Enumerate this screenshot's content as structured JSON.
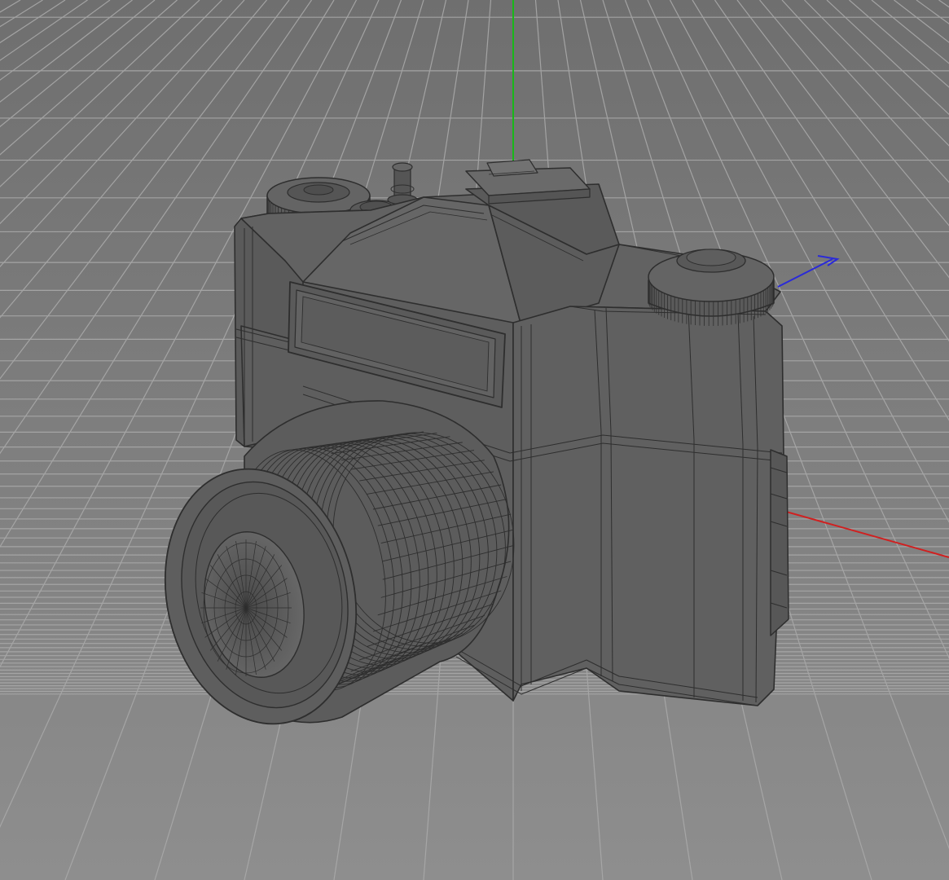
{
  "viewport": {
    "view": "perspective",
    "display_mode": "wireframe-on-shaded",
    "background_top": "#6f6f6f",
    "background_bottom": "#8e8e8e",
    "grid_color": "#a9a9a9",
    "object_color": "#5e5e5e",
    "wire_color": "#2e2e2e"
  },
  "axes": {
    "x_color": "#d02020",
    "y_color": "#18b818",
    "z_color": "#2a2ad8"
  },
  "object": {
    "kind": "camera-model",
    "parts": [
      "body",
      "pentaprism-housing",
      "hot-shoe",
      "name-plate",
      "lens",
      "rewind-knob",
      "shutter-dial",
      "release-button",
      "side-strap-lug"
    ]
  }
}
